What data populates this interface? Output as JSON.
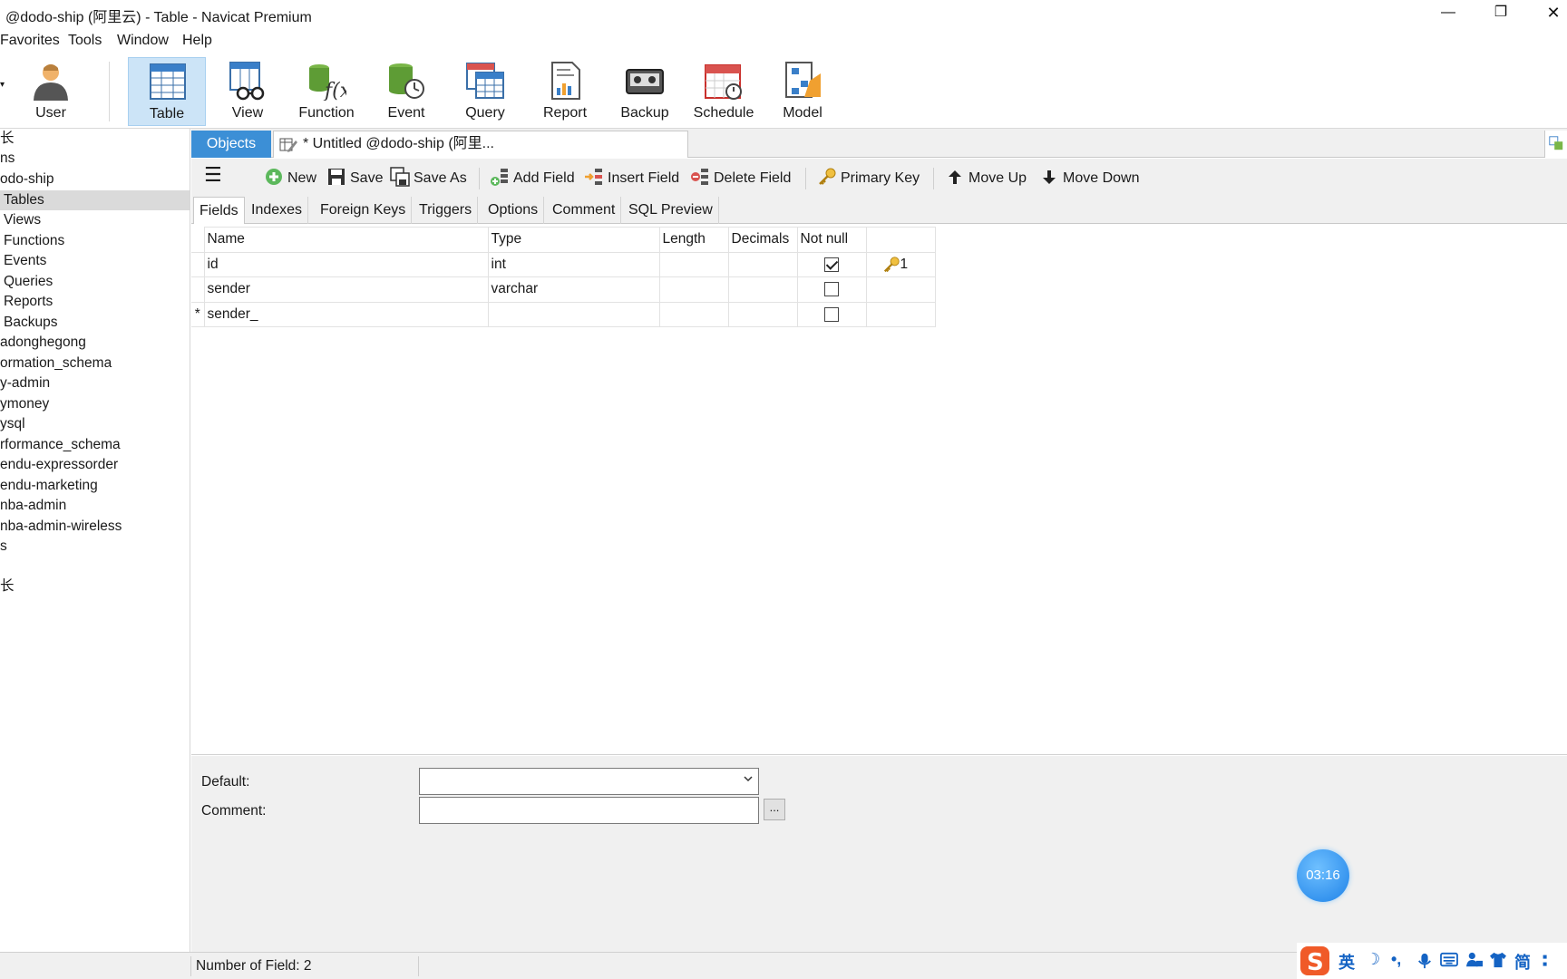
{
  "window": {
    "title": "@dodo-ship (阿里云) - Table - Navicat Premium",
    "min_glyph": "—",
    "max_glyph": "❐",
    "close_glyph": "✕"
  },
  "menu": [
    "Favorites",
    "Tools",
    "Window",
    "Help"
  ],
  "ribbon": {
    "dropdown_glyph": "▾",
    "buttons": [
      {
        "label": "User",
        "icon": "user-icon"
      },
      {
        "label": "Table",
        "icon": "table-icon",
        "active": true
      },
      {
        "label": "View",
        "icon": "view-icon"
      },
      {
        "label": "Function",
        "icon": "function-icon"
      },
      {
        "label": "Event",
        "icon": "event-icon"
      },
      {
        "label": "Query",
        "icon": "query-icon"
      },
      {
        "label": "Report",
        "icon": "report-icon"
      },
      {
        "label": "Backup",
        "icon": "backup-icon"
      },
      {
        "label": "Schedule",
        "icon": "schedule-icon"
      },
      {
        "label": "Model",
        "icon": "model-icon"
      }
    ]
  },
  "sidebar": {
    "items": [
      "长",
      "ns",
      "odo-ship",
      "Tables",
      "Views",
      "Functions",
      "Events",
      "Queries",
      "Reports",
      "Backups",
      "adonghegong",
      "ormation_schema",
      "y-admin",
      "ymoney",
      "ysql",
      "rformance_schema",
      "endu-expressorder",
      "endu-marketing",
      "nba-admin",
      "nba-admin-wireless",
      "s",
      "长"
    ],
    "selected": "Tables"
  },
  "tabs": {
    "objects": "Objects",
    "untitled": "* Untitled @dodo-ship (阿里..."
  },
  "toolbar": {
    "menu_glyph": "☰",
    "new": "New",
    "save": "Save",
    "save_as": "Save As",
    "add_field": "Add Field",
    "insert_field": "Insert Field",
    "delete_field": "Delete Field",
    "primary_key": "Primary Key",
    "move_up": "Move Up",
    "move_down": "Move Down"
  },
  "subtabs": [
    "Fields",
    "Indexes",
    "Foreign Keys",
    "Triggers",
    "Options",
    "Comment",
    "SQL Preview"
  ],
  "grid": {
    "headers": [
      "Name",
      "Type",
      "Length",
      "Decimals",
      "Not null",
      ""
    ],
    "rows": [
      {
        "marker": "",
        "name": "id",
        "type": "int",
        "length": "",
        "decimals": "",
        "not_null": true,
        "key": "1"
      },
      {
        "marker": "",
        "name": "sender",
        "type": "varchar",
        "length": "",
        "decimals": "",
        "not_null": false,
        "key": ""
      },
      {
        "marker": "*",
        "name": "sender_",
        "type": "",
        "length": "",
        "decimals": "",
        "not_null": false,
        "key": ""
      }
    ]
  },
  "props": {
    "default_label": "Default:",
    "comment_label": "Comment:",
    "dots": "..."
  },
  "timer": "03:16",
  "status": {
    "text": "Number of Field: 2"
  },
  "ime": {
    "lang": "英",
    "moon": "☽",
    "punct": "•,",
    "simplified": "简"
  }
}
